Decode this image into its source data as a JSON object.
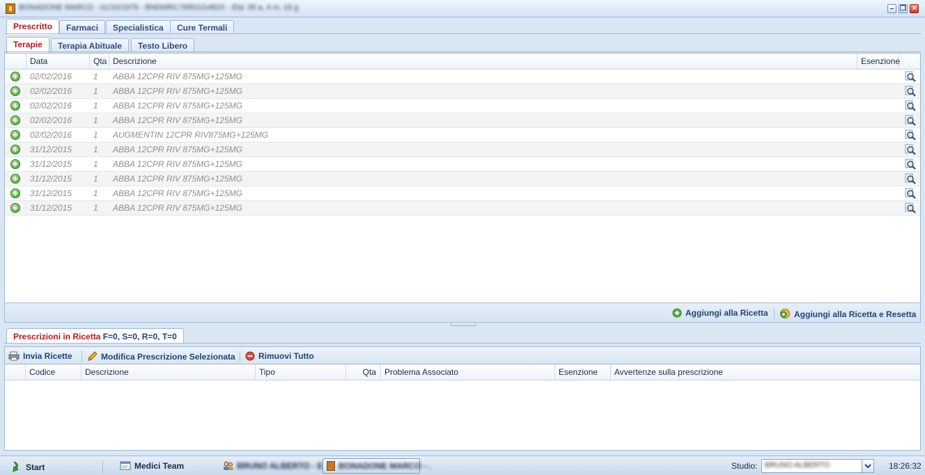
{
  "window": {
    "title": "BONADONE MARCO - 01/10/1976 - BNDMRC76R01G482X - Eta' 39 a, 4 m, 16 g",
    "controls": [
      "minimize",
      "restore",
      "close"
    ]
  },
  "main_tabs": [
    {
      "label": "Prescritto",
      "active": true
    },
    {
      "label": "Farmaci",
      "active": false
    },
    {
      "label": "Specialistica",
      "active": false
    },
    {
      "label": "Cure Termali",
      "active": false
    }
  ],
  "sub_tabs": [
    {
      "label": "Terapie",
      "active": true
    },
    {
      "label": "Terapia Abituale",
      "active": false
    },
    {
      "label": "Testo Libero",
      "active": false
    }
  ],
  "therapy_grid": {
    "headers": {
      "data": "Data",
      "qta": "Qta",
      "descrizione": "Descrizione",
      "esenzione": "Esenzione"
    },
    "rows": [
      {
        "data": "02/02/2016",
        "qta": "1",
        "descrizione": "ABBA 12CPR RIV 875MG+125MG",
        "esenzione": ""
      },
      {
        "data": "02/02/2016",
        "qta": "1",
        "descrizione": "ABBA 12CPR RIV 875MG+125MG",
        "esenzione": ""
      },
      {
        "data": "02/02/2016",
        "qta": "1",
        "descrizione": "ABBA 12CPR RIV 875MG+125MG",
        "esenzione": ""
      },
      {
        "data": "02/02/2016",
        "qta": "1",
        "descrizione": "ABBA 12CPR RIV 875MG+125MG",
        "esenzione": ""
      },
      {
        "data": "02/02/2016",
        "qta": "1",
        "descrizione": "AUGMENTIN 12CPR RIV875MG+125MG",
        "esenzione": ""
      },
      {
        "data": "31/12/2015",
        "qta": "1",
        "descrizione": "ABBA 12CPR RIV 875MG+125MG",
        "esenzione": ""
      },
      {
        "data": "31/12/2015",
        "qta": "1",
        "descrizione": "ABBA 12CPR RIV 875MG+125MG",
        "esenzione": ""
      },
      {
        "data": "31/12/2015",
        "qta": "1",
        "descrizione": "ABBA 12CPR RIV 875MG+125MG",
        "esenzione": ""
      },
      {
        "data": "31/12/2015",
        "qta": "1",
        "descrizione": "ABBA 12CPR RIV 875MG+125MG",
        "esenzione": ""
      },
      {
        "data": "31/12/2015",
        "qta": "1",
        "descrizione": "ABBA 12CPR RIV 875MG+125MG",
        "esenzione": ""
      }
    ]
  },
  "top_actions": {
    "add_label": "Aggiungi alla Ricetta",
    "add_reset_label": "Aggiungi alla Ricetta e Resetta"
  },
  "prescriptions_tab": {
    "label": "Prescrizioni in Ricetta ",
    "f": "F=0,",
    "s": "S=0,",
    "r": "R=0,",
    "t": "T=0"
  },
  "bottom_toolbar": {
    "send_label": "Invia Ricette",
    "edit_label": "Modifica Prescrizione Selezionata",
    "remove_label": "Rimuovi Tutto"
  },
  "prescription_grid": {
    "headers": {
      "codice": "Codice",
      "descrizione": "Descrizione",
      "tipo": "Tipo",
      "qta": "Qta",
      "problema": "Problema Associato",
      "esenzione": "Esenzione",
      "avvertenze": "Avvertenze sulla prescrizione"
    },
    "rows": []
  },
  "taskbar": {
    "start_label": "Start",
    "medici_team_label": "Medici Team",
    "task_user_label": "BRUNO ALBERTO - E..",
    "task_current_label": "BONADONE MARCO - .",
    "studio_label": "Studio:",
    "studio_value": "BRUNO ALBERTO",
    "clock": "18:26:32"
  }
}
